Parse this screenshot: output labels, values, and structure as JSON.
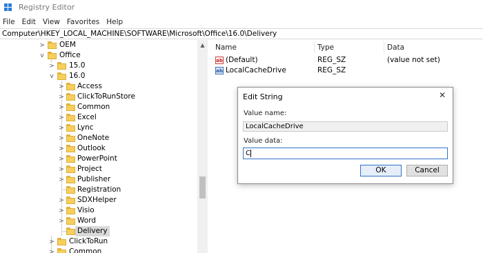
{
  "window": {
    "title": "Registry Editor"
  },
  "menu": [
    "File",
    "Edit",
    "View",
    "Favorites",
    "Help"
  ],
  "address": "Computer\\HKEY_LOCAL_MACHINE\\SOFTWARE\\Microsoft\\Office\\16.0\\Delivery",
  "tree": {
    "oem": "OEM",
    "office": "Office",
    "v15": "15.0",
    "v16": "16.0",
    "children_16": [
      "Access",
      "ClickToRunStore",
      "Common",
      "Excel",
      "Lync",
      "OneNote",
      "Outlook",
      "PowerPoint",
      "Project",
      "Publisher",
      "Registration",
      "SDXHelper",
      "Visio",
      "Word",
      "Delivery"
    ],
    "after": [
      "ClickToRun",
      "Common"
    ]
  },
  "list": {
    "headers": {
      "name": "Name",
      "type": "Type",
      "data": "Data"
    },
    "rows": [
      {
        "name": "(Default)",
        "type": "REG_SZ",
        "data": "(value not set)",
        "icon": "string-value-icon"
      },
      {
        "name": "LocalCacheDrive",
        "type": "REG_SZ",
        "data": "",
        "icon": "binary-value-icon"
      }
    ]
  },
  "dialog": {
    "title": "Edit String",
    "close_glyph": "✕",
    "value_name_label": "Value name:",
    "value_name": "LocalCacheDrive",
    "value_data_label": "Value data:",
    "value_data": "C",
    "ok": "OK",
    "cancel": "Cancel"
  },
  "colors": {
    "accent": "#2f72c9",
    "folder": "#f6cf5c",
    "selection": "#d9d9d9"
  }
}
